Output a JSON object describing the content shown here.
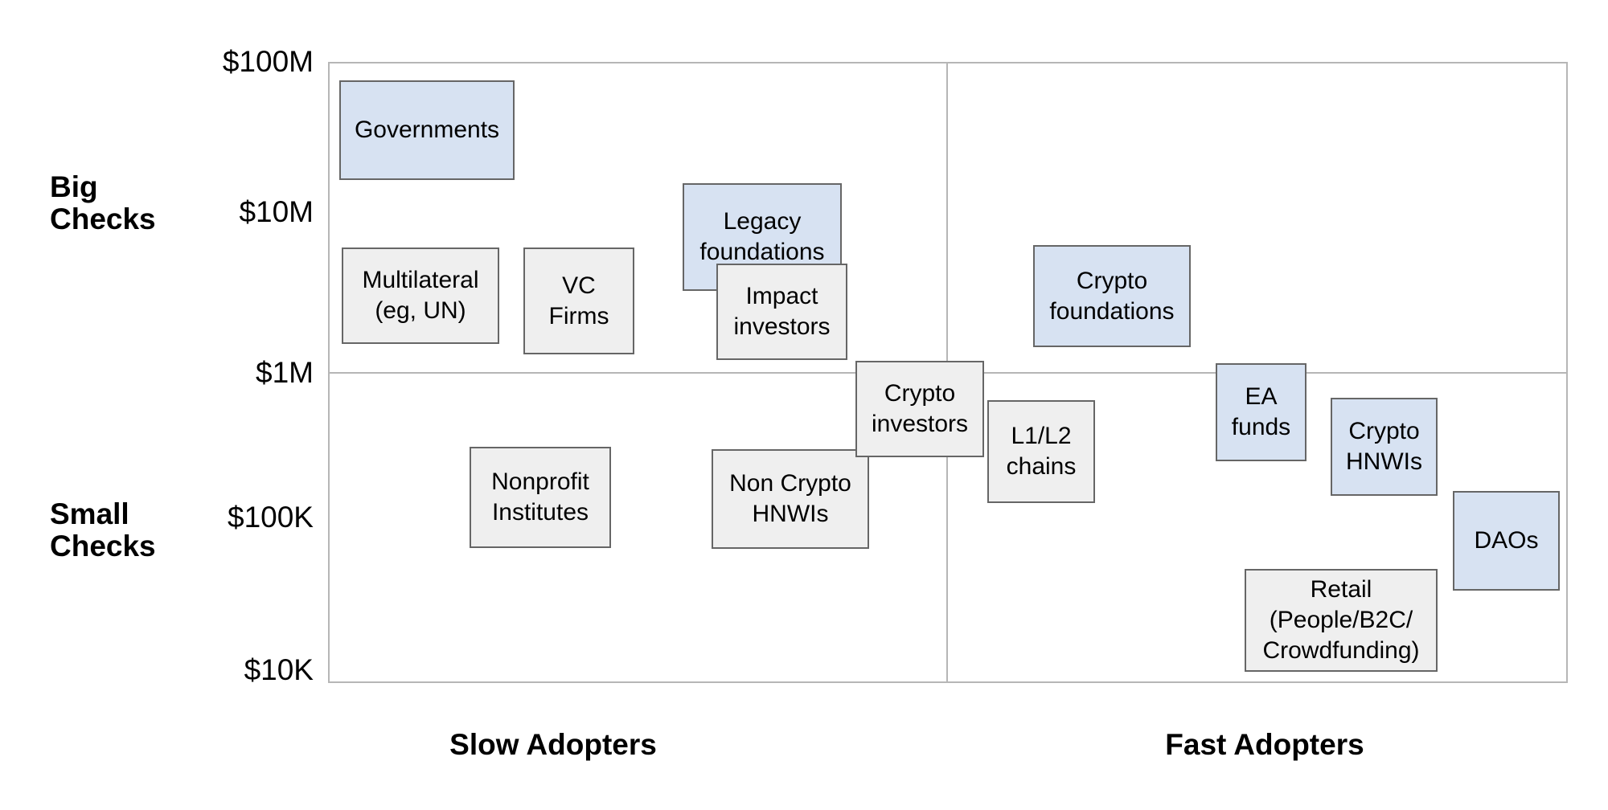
{
  "chart_data": {
    "type": "scatter",
    "title": "",
    "xlabel": "",
    "ylabel": "",
    "grid": false,
    "legend": "none",
    "axes": {
      "y": {
        "scale": "log",
        "ticks": [
          "$100M",
          "$10M",
          "$1M",
          "$100K",
          "$10K"
        ],
        "groups": [
          "Big\nChecks",
          "Small\nChecks"
        ]
      },
      "x": {
        "scale": "categorical",
        "categories": [
          "Slow Adopters",
          "Fast Adopters"
        ]
      }
    },
    "colors": {
      "blue_fill": "#d7e2f2",
      "gray_fill": "#efefef",
      "box_border": "#666666",
      "frame": "#b6b6b6",
      "text": "#000000"
    },
    "nodes": [
      {
        "id": "governments",
        "label": "Governments",
        "fill": "blue",
        "x_group": "Slow Adopters",
        "y_band": "Big Checks",
        "approx_value": "$30M"
      },
      {
        "id": "multilateral",
        "label": "Multilateral\n(eg, UN)",
        "fill": "gray",
        "x_group": "Slow Adopters",
        "y_band": "Big Checks",
        "approx_value": "$3M"
      },
      {
        "id": "vc-firms",
        "label": "VC\nFirms",
        "fill": "gray",
        "x_group": "Slow Adopters",
        "y_band": "Big Checks",
        "approx_value": "$3M"
      },
      {
        "id": "legacy-foundations",
        "label": "Legacy\nfoundations",
        "fill": "blue",
        "x_group": "Slow Adopters",
        "y_band": "Big Checks",
        "approx_value": "$10M"
      },
      {
        "id": "impact-investors",
        "label": "Impact\ninvestors",
        "fill": "gray",
        "x_group": "Slow Adopters",
        "y_band": "Big Checks",
        "approx_value": "$2M"
      },
      {
        "id": "crypto-foundations",
        "label": "Crypto\nfoundations",
        "fill": "blue",
        "x_group": "Fast Adopters",
        "y_band": "Big Checks",
        "approx_value": "$3M"
      },
      {
        "id": "crypto-investors",
        "label": "Crypto\ninvestors",
        "fill": "gray",
        "x_group": "Slow Adopters",
        "y_band": "Small Checks",
        "approx_value": "$700K"
      },
      {
        "id": "l1-l2-chains",
        "label": "L1/L2\nchains",
        "fill": "gray",
        "x_group": "Slow Adopters",
        "y_band": "Small Checks",
        "approx_value": "$400K"
      },
      {
        "id": "ea-funds",
        "label": "EA\nfunds",
        "fill": "blue",
        "x_group": "Fast Adopters",
        "y_band": "Small Checks",
        "approx_value": "$700K"
      },
      {
        "id": "crypto-hnwis",
        "label": "Crypto\nHNWIs",
        "fill": "blue",
        "x_group": "Fast Adopters",
        "y_band": "Small Checks",
        "approx_value": "$400K"
      },
      {
        "id": "nonprofit-institutes",
        "label": "Nonprofit\nInstitutes",
        "fill": "gray",
        "x_group": "Slow Adopters",
        "y_band": "Small Checks",
        "approx_value": "$150K"
      },
      {
        "id": "non-crypto-hnwis",
        "label": "Non Crypto\nHNWIs",
        "fill": "gray",
        "x_group": "Slow Adopters",
        "y_band": "Small Checks",
        "approx_value": "$150K"
      },
      {
        "id": "daos",
        "label": "DAOs",
        "fill": "blue",
        "x_group": "Fast Adopters",
        "y_band": "Small Checks",
        "approx_value": "$80K"
      },
      {
        "id": "retail",
        "label": "Retail\n(People/B2C/\nCrowdfunding)",
        "fill": "gray",
        "x_group": "Fast Adopters",
        "y_band": "Small Checks",
        "approx_value": "$50K"
      }
    ]
  },
  "axis": {
    "y_ticks": {
      "t100m": "$100M",
      "t10m": "$10M",
      "t1m": "$1M",
      "t100k": "$100K",
      "t10k": "$10K"
    },
    "y_groups": {
      "big": "Big\nChecks",
      "small": "Small\nChecks"
    },
    "x_groups": {
      "slow": "Slow Adopters",
      "fast": "Fast Adopters"
    }
  },
  "boxes": {
    "governments": "Governments",
    "multilateral": "Multilateral\n(eg, UN)",
    "vc_firms": "VC\nFirms",
    "legacy_foundations": "Legacy\nfoundations",
    "impact_investors": "Impact\ninvestors",
    "crypto_foundations": "Crypto\nfoundations",
    "crypto_investors": "Crypto\ninvestors",
    "l1_l2_chains": "L1/L2\nchains",
    "ea_funds": "EA\nfunds",
    "crypto_hnwis": "Crypto\nHNWIs",
    "nonprofit_institutes": "Nonprofit\nInstitutes",
    "non_crypto_hnwis": "Non Crypto\nHNWIs",
    "daos": "DAOs",
    "retail": "Retail\n(People/B2C/\nCrowdfunding)"
  }
}
